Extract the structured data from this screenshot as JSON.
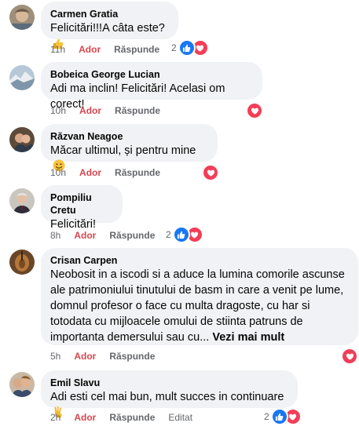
{
  "comments": [
    {
      "author": "Carmen Gratia",
      "text": "Felicitări!!!A câta este?",
      "emoji": "thumbs-up-emoji",
      "time": "11h",
      "like": "Ador",
      "reply": "Răspunde",
      "reaction_count": "2",
      "reactions": [
        "like-icon",
        "love-icon"
      ]
    },
    {
      "author": "Bobeica George Lucian",
      "text": "Adi ma inclin! Felicitări! Acelasi om corect!",
      "time": "10h",
      "like": "Ador",
      "reply": "Răspunde",
      "reactions": [
        "love-icon"
      ]
    },
    {
      "author": "Răzvan Neagoe",
      "text": "Măcar ultimul, și pentru mine",
      "emoji": "smile-emoji",
      "time": "10h",
      "like": "Ador",
      "reply": "Răspunde",
      "reactions": [
        "love-icon"
      ]
    },
    {
      "author": "Pompiliu Cretu",
      "text": "Felicitări!",
      "time": "8h",
      "like": "Ador",
      "reply": "Răspunde",
      "reaction_count": "2",
      "reactions": [
        "like-icon",
        "love-icon"
      ]
    },
    {
      "author": "Crisan Carpen",
      "text": "Neobosit in a iscodi si a aduce la lumina comorile ascunse ale patrimoniului tinutului de basm in care a venit pe lume, domnul profesor o face cu multa dragoste, cu har si totodata cu mijloacele omului de stiinta patruns de importanta demersului sau cu...",
      "see_more": "Vezi mai mult",
      "time": "5h",
      "like": "Ador",
      "reply": "Răspunde",
      "reactions": [
        "love-icon"
      ]
    },
    {
      "author": "Emil Slavu",
      "text": "Adi esti cel mai bun, mult succes in continuare",
      "emoji": "victory-hand-emoji",
      "time": "2h",
      "like": "Ador",
      "reply": "Răspunde",
      "edited": "Editat",
      "reaction_count": "2",
      "reactions": [
        "like-icon",
        "love-icon"
      ]
    }
  ],
  "colors": {
    "bubble": "#f0f2f5",
    "like_blue": "#1877f2",
    "love_red": "#f33e58",
    "action_liked": "#d8464f",
    "meta_gray": "#65676b"
  }
}
